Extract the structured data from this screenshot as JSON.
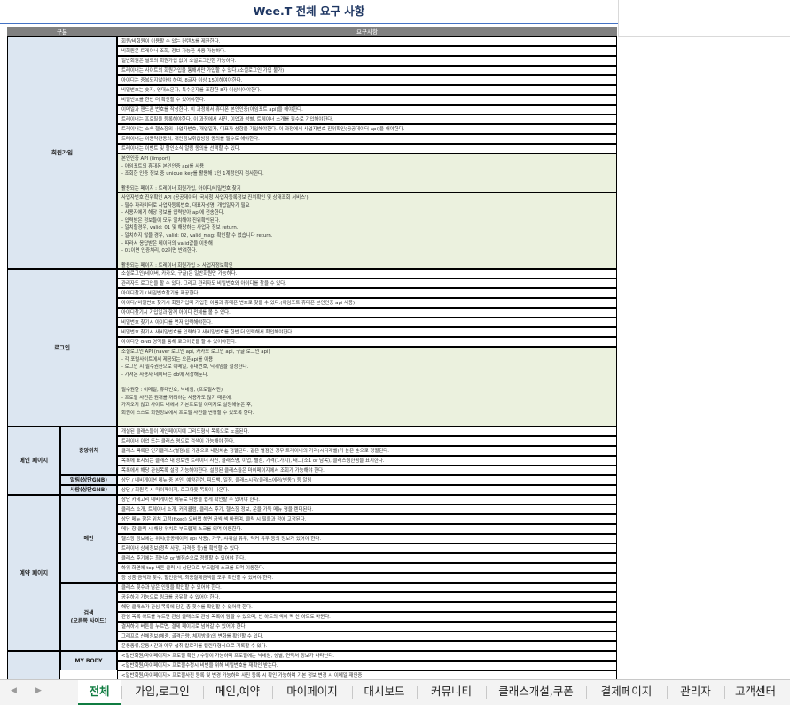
{
  "sheet": {
    "title": "Wee.T 전체 요구 사항",
    "header": {
      "group": "구분",
      "req": "요구사항"
    }
  },
  "categories": [
    {
      "label": "회원가입",
      "y": 0
    },
    {
      "label": "로그인"
    },
    {
      "label": "메인 페이지"
    },
    {
      "label": "예약 페이지"
    }
  ],
  "subs": [
    {
      "label": "중앙위치"
    },
    {
      "label": "알림(상단GNB)"
    },
    {
      "label": "사람(상단GNB)"
    },
    {
      "label": "메인"
    },
    {
      "label": "검색\n(오른쪽 사이드)"
    },
    {
      "label": "MY BODY"
    }
  ],
  "reqs": [
    "회원/비회원이 이용할 수 있는 컨텐츠를 제한한다.",
    "비회원은 트레이너 조회, 정보 가능한 사용 가능하다.",
    "일반회원은 별도의 회원가입 없이 소셜로그인한 가능하다.",
    "트레이너는 사이트의 회원가입을 통해서만 가입할 수 있다.(소셜로그인 가입 불가)",
    "아이디는 중복되지않아야 하며, 8글자 이상 15이하여야한다.",
    "비밀번호는 숫자, 영대소문자, 특수문자를 포함한 8자 이상이어야한다.",
    "비밀번호를 한번 더 확인할 수 있어야한다.",
    "이메일과 핸드폰 번호를 작성한다. 이 과정에서 휴대폰 본인인증(아임포트 api)을 해야한다.",
    "트레이너는 프로필을 등록해야한다. 이 과정에서 사진, 이업과 성별, 트레이너 소개를 필수로 기입해야한다.",
    "트레이너는 소속 헬스장의 사업자번호, 개업일자, 대표자 성함을 기입해야한다. 이 과정에서 사업자번호 진위확인(공공데이터 api)을 해야한다.",
    "트레이너는 이용약관동의, 개인정보취급방침 동의를 필수로 해야한다.",
    "트레이너는 이벤트 및 할인소식 알림 동의를 선택할 수 있다.",
    "본인인증 API (iimport)\n- 아임포트의 휴대폰 본인인증 api를 사용\n- 조회한 인증 정보 중 unique_key를 활용해 1인 1계정인지 검사한다.\n\n활용되는 페이지 : 트레이너 회원가입, 아이디/비밀번호 찾기",
    "사업자번호 진위확인 API (공공데이터 '국세청_사업자등록정보 진위확인 및 상태조회 서비스')\n- 필수 파라미터로 사업자등록번호, 대표자성명, 개업일자가 필요\n- 사용자에게 해당 정보를 입력받아 api에 전송한다.\n- 입력받은 정보들이 모두 일치해야 진위확인된다.\n- 일치할경우, valid: 01 및 해당하는 사업자 정보 return.\n- 일치하지 않을 경우, valid: 02, valid_msg: 확인할 수 없습니다 return.\n- 따라서 응답받은 데이터의 valid값을 이용해\n- 01이면 인증처리, 02이면 반려한다.\n\n활용되는 페이지 : 트레이너 회원가입 > 사업자정보확인",
    "소셜로그인(네이버, 카카오, 구글)은 일반회원만 가능하다.",
    "관리자도 로그인을 할 수 있다. 그리고 관리자도 비밀번호와 아이디를 찾을 수 있다.",
    "아이디찾기 / 비밀번호찾기를 제공한다.",
    "아이디/ 비밀번호 찾기시 회원가입때 기입한 이름과 휴대폰 번호로 찾을 수 있다.(아임포트 휴대폰 본인인증 api 사용)",
    "아이디찾기시 가입일과 함께 아이디 전체를 볼 수 있다.",
    "비밀번호 찾기시 아이디를 먼저 입력해야한다.",
    "비밀번호 찾기시 새비밀번호를 입력하고 새비밀번호를 한번 더 입력해서 확인해야한다.",
    "아이디만 GNB 영역을 통해 로그아웃을 할 수 있어야한다.",
    "소셜로그인 API (naver 로그인 api, 카카오 로그인 api, 구글 로그인 api)\n- 각 포털사이트에서 제공되는 오픈api를 이용\n- 로그인 시 필수권한으로 이메일, 휴대번호, 닉네임을 설정한다.\n- 가져온 사용자 데이터는 db에 저장해둔다.\n\n필수권한 : 이메일, 휴대번호, 닉네임, (프로필사진)\n- 프로필 사진은 권개를 꺼려하는 사용자도 많기 때문에,\n가져오지 않고 사이트 내에서 기본프로필 이미지로 설정해놓은 후,\n회원이 스스로 회원정보에서 프로필 사진을 변경할 수 있도록 한다.",
    "개설된 클래스들이 메인페이지에 그리드형식 목록으로 노출된다.",
    "트레이너 이업 또는 클래스 명으로 검색이 가능해야 한다.",
    "클래스 목록은 인기클래스(별점)를 기준으로 내림차순 정렬된다. 같은 별점인 경우 트레이너의 거리(시티레벨)가 높은 순으로 정렬된다.",
    "목록에 표시되는 클래스 내 정보엔 트레이너 사진, 클래스명, 이업, 별점, 가격(1가지), 태그(소1 or 남목), 클래스찜한됨을 표시한다.",
    "목록에서 해당 관심목록 설정 가능해야한다. 설정된 클래스들은 마이페이지에서 조회가 가능해야 한다.",
    "상단 / 네비게이션 메뉴 중 본인, 예약관련, 피드백, 일정, 클래스시작(클래스에러(변동)) 등 알림",
    "상단 / 회원목 시 마이페이지, 로그아웃 목록이 나온다.",
    "상단 카테고리 네비게이션 메뉴로 내용을 쉽게 확인할 수 있어야 한다.",
    "클래스 소개, 트레이너 소개, 커리큘럼, 클래스 후기, 헬스장 정보, 운을 가득 메뉴 형을 렌더된다.",
    "상단 메뉴 항은 위치 고정(fixed) 오버랩 하면 금씩 섹 바뀌며, 클릭 시 필을과 정에 고정된다.",
    "메뉴 항 클릭 시 해당 위치로 부드럽게 스크롤 되며 이동한다.",
    "헬스장 정보에는 위치(공공데이터 api 사용), 가구, 샤워실 유무, 락커 유무 등의 정보가 있어야 한다.",
    "트레이너 상세정보(정착 사항, 자격증 등)를 확인할 수 있다.",
    "클래스 후기에는 최신순 or 별점순으로 정렬할 수 있어야 한다.",
    "하위 화면에 top 버튼 클릭 시 상단으로 부드럽게 스크롤 되며 이동한다.",
    "등 상품 금액과 횟수, 할인금액, 최종결제금액을 모두 확인할 수 있어야 한다.",
    "클래스 횟수과 남은 인원을 확인할 수 있어야 한다.",
    "공유하기 가능으로 링크를 공유할 수 있어야 한다.",
    "해당 클래스가 관심 목록에 담긴 총 횟수를 확인할 수 있어야 한다.",
    "관심 목록 하트를 누르면 관심 클래스로 관심 목록에 담을 수 있으며, 빈 하트의 색이 꽉 찬 하트로 바뀐다.",
    "결제하기 버튼을 누르면, 결제 페이지로 넘어갈 수 있어야 한다.",
    "그래프로 신체정보(체중, 골격근량, 체지방율)의 변화를 확인할 수 있다.",
    "운동종류,운동시간과 아무 섭취 칼로리를 캘린더형식으로 기록할 수 있다.",
    "<일반회원/마이페이지> 프로필 확인 / 수정이 가능하며 프로필에는 닉네임, 성별, 연락처 정보가 나타난다.",
    "<일반회원/마이페이지> 프로필수정시 비번을 위해 비밀번호를 재확인 받는다.",
    "<일반회원/마이페이지> 프로필사진 등록 및 변경 가능하며 사진 등록 시 확인 가능하며 기본 정보 변경 시 이메일 재인증"
  ],
  "tabs": [
    {
      "label": "전체",
      "active": true
    },
    {
      "label": "가입,로그인"
    },
    {
      "label": "메인,예약"
    },
    {
      "label": "마이페이지"
    },
    {
      "label": "대시보드"
    },
    {
      "label": "커뮤니티"
    },
    {
      "label": "클래스개설,쿠폰"
    },
    {
      "label": "결제페이지"
    },
    {
      "label": "관리자"
    },
    {
      "label": "고객센터"
    }
  ],
  "nav": {
    "prev": "◀",
    "next": "▶"
  }
}
